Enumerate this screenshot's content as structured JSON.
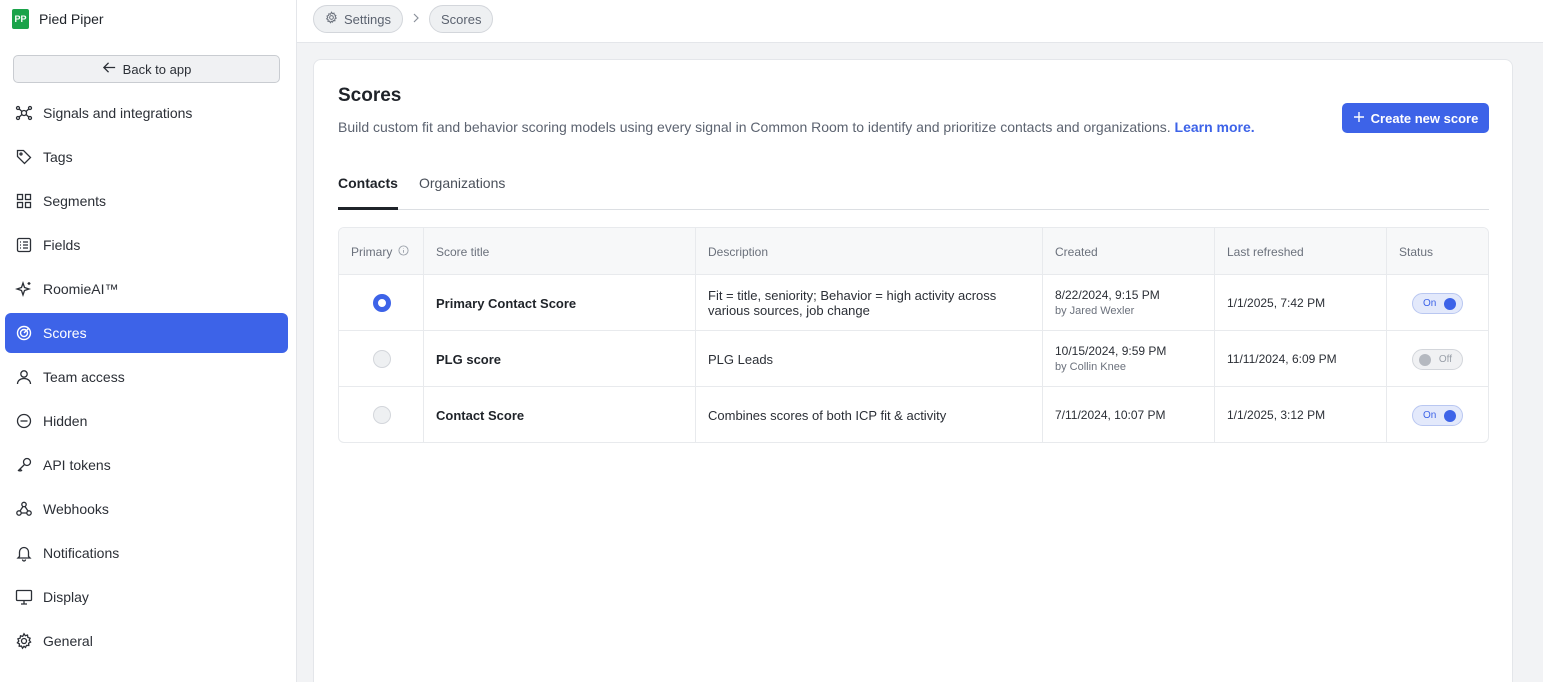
{
  "brand": {
    "name": "Pied Piper",
    "logo_text": "PP"
  },
  "sidebar": {
    "back_label": "Back to app",
    "items": [
      {
        "label": "Signals and integrations",
        "icon": "signals-icon"
      },
      {
        "label": "Tags",
        "icon": "tag-icon"
      },
      {
        "label": "Segments",
        "icon": "grid-icon"
      },
      {
        "label": "Fields",
        "icon": "fields-icon"
      },
      {
        "label": "RoomieAI™",
        "icon": "sparkle-icon"
      },
      {
        "label": "Scores",
        "icon": "scores-icon",
        "active": true
      },
      {
        "label": "Team access",
        "icon": "user-icon"
      },
      {
        "label": "Hidden",
        "icon": "hidden-icon"
      },
      {
        "label": "API tokens",
        "icon": "key-icon"
      },
      {
        "label": "Webhooks",
        "icon": "webhook-icon"
      },
      {
        "label": "Notifications",
        "icon": "bell-icon"
      },
      {
        "label": "Display",
        "icon": "monitor-icon"
      },
      {
        "label": "General",
        "icon": "gear-icon"
      }
    ]
  },
  "breadcrumb": {
    "settings": "Settings",
    "scores": "Scores"
  },
  "main": {
    "title": "Scores",
    "subtitle": "Build custom fit and behavior scoring models using every signal in Common Room to identify and prioritize contacts and organizations.",
    "learn_more": "Learn more.",
    "create_button": "Create new score",
    "tabs": [
      {
        "label": "Contacts",
        "active": true
      },
      {
        "label": "Organizations",
        "active": false
      }
    ]
  },
  "table": {
    "columns": {
      "primary": "Primary",
      "title": "Score title",
      "description": "Description",
      "created": "Created",
      "refreshed": "Last refreshed",
      "status": "Status"
    },
    "rows": [
      {
        "primary": true,
        "title": "Primary Contact Score",
        "description": "Fit = title, seniority; Behavior = high activity across various sources, job change",
        "created": "8/22/2024, 9:15 PM",
        "created_by": "by Jared Wexler",
        "refreshed": "1/1/2025, 7:42 PM",
        "status": "On"
      },
      {
        "primary": false,
        "title": "PLG score",
        "description": "PLG Leads",
        "created": "10/15/2024, 9:59 PM",
        "created_by": "by Collin Knee",
        "refreshed": "11/11/2024, 6:09 PM",
        "status": "Off"
      },
      {
        "primary": false,
        "title": "Contact Score",
        "description": "Combines scores of both ICP fit & activity",
        "created": "7/11/2024, 10:07 PM",
        "created_by": "",
        "refreshed": "1/1/2025, 3:12 PM",
        "status": "On"
      }
    ]
  },
  "colors": {
    "accent": "#3d63e8",
    "brand": "#1aa34a"
  }
}
